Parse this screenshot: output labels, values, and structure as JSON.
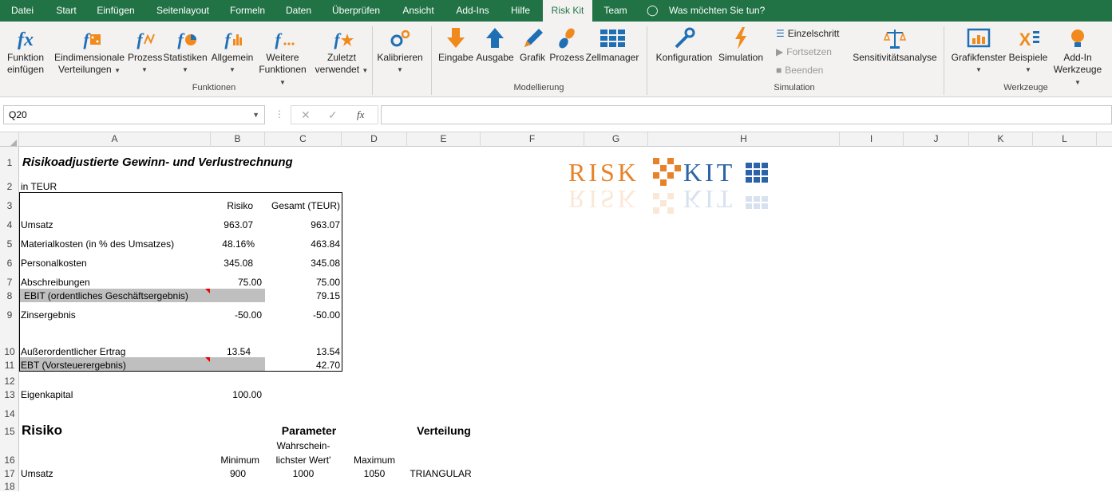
{
  "tabs": [
    "Datei",
    "Start",
    "Einfügen",
    "Seitenlayout",
    "Formeln",
    "Daten",
    "Überprüfen",
    "Ansicht",
    "Add-Ins",
    "Hilfe",
    "Risk Kit",
    "Team"
  ],
  "tell_me": "Was möchten Sie tun?",
  "ribbon": {
    "funktion_einfuegen": [
      "Funktion",
      "einfügen"
    ],
    "eindim": [
      "Eindimensionale",
      "Verteilungen"
    ],
    "prozess": "Prozess",
    "statistiken": "Statistiken",
    "allgemein": "Allgemein",
    "weitere": [
      "Weitere",
      "Funktionen"
    ],
    "zuletzt": [
      "Zuletzt",
      "verwendet"
    ],
    "kalibrieren": "Kalibrieren",
    "eingabe": "Eingabe",
    "ausgabe": "Ausgabe",
    "grafik": "Grafik",
    "prozess2": "Prozess",
    "zellmanager": "Zellmanager",
    "konfiguration": "Konfiguration",
    "simulation": "Simulation",
    "einzelschritt": "Einzelschritt",
    "fortsetzen": "Fortsetzen",
    "beenden": "Beenden",
    "sensitivitaet": "Sensitivitätsanalyse",
    "grafikfenster": "Grafikfenster",
    "beispiele": "Beispiele",
    "addin": [
      "Add-In",
      "Werkzeuge"
    ],
    "groups": {
      "funktionen": "Funktionen",
      "modellierung": "Modellierung",
      "simulation": "Simulation",
      "werkzeuge": "Werkzeuge"
    }
  },
  "name_box": "Q20",
  "fx": "fx",
  "columns": [
    "A",
    "B",
    "C",
    "D",
    "E",
    "F",
    "G",
    "H",
    "I",
    "J",
    "K",
    "L"
  ],
  "rows": [
    "1",
    "2",
    "3",
    "4",
    "5",
    "6",
    "7",
    "8",
    "9",
    "10",
    "11",
    "12",
    "13",
    "14",
    "15",
    "16",
    "17",
    "18"
  ],
  "logo": {
    "risk": "RISK",
    "kit": "KIT"
  },
  "sheet": {
    "title": "Risikoadjustierte Gewinn- und Verlustrechnung",
    "unit": "in TEUR",
    "h_risiko": "Risiko",
    "h_gesamt": "Gesamt (TEUR)",
    "lines": [
      {
        "label": "Umsatz",
        "risiko": "963.07",
        "gesamt": "963.07"
      },
      {
        "label": "Materialkosten (in % des Umsatzes)",
        "risiko": "48.16%",
        "gesamt": "463.84"
      },
      {
        "label": "Personalkosten",
        "risiko": "345.08",
        "gesamt": "345.08"
      },
      {
        "label": "Abschreibungen",
        "risiko": "75.00",
        "gesamt": "75.00"
      },
      {
        "label": "EBIT (ordentliches Geschäftsergebnis)",
        "risiko": "",
        "gesamt": "79.15"
      },
      {
        "label": "Zinsergebnis",
        "risiko": "-50.00",
        "gesamt": "-50.00"
      },
      {
        "label": "Außerordentlicher Ertrag",
        "risiko": "13.54",
        "gesamt": "13.54"
      },
      {
        "label": "EBT (Vorsteuerergebnis)",
        "risiko": "",
        "gesamt": "42.70"
      }
    ],
    "eigenkapital_label": "Eigenkapital",
    "eigenkapital_value": "100.00",
    "risiko_header": "Risiko",
    "parameter_header": "Parameter",
    "verteilung_header": "Verteilung",
    "minimum": "Minimum",
    "wahrsch": [
      "Wahrschein-",
      "lichster Wert'"
    ],
    "maximum": "Maximum",
    "umsatz_row": {
      "label": "Umsatz",
      "min": "900",
      "ml": "1000",
      "max": "1050",
      "dist": "TRIANGULAR"
    }
  }
}
